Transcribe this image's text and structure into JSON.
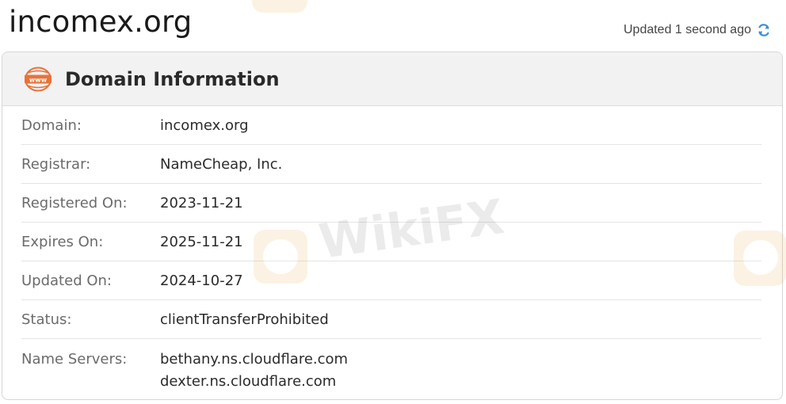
{
  "header": {
    "domain_title": "incomex.org",
    "updated_text": "Updated 1 second ago"
  },
  "panel": {
    "title": "Domain Information",
    "rows": [
      {
        "label": "Domain:",
        "value": "incomex.org"
      },
      {
        "label": "Registrar:",
        "value": "NameCheap, Inc."
      },
      {
        "label": "Registered On:",
        "value": "2023-11-21"
      },
      {
        "label": "Expires On:",
        "value": "2025-11-21"
      },
      {
        "label": "Updated On:",
        "value": "2024-10-27"
      },
      {
        "label": "Status:",
        "value": "clientTransferProhibited"
      },
      {
        "label": "Name Servers:",
        "values": [
          "bethany.ns.cloudflare.com",
          "dexter.ns.cloudflare.com"
        ]
      }
    ]
  },
  "watermark": {
    "text": "WikiFX"
  },
  "colors": {
    "accent_orange": "#e8733a",
    "refresh_blue": "#3d8fd6",
    "header_bg": "#f2f2f2"
  },
  "icons": {
    "refresh": "refresh-icon",
    "www": "www-globe-icon"
  }
}
